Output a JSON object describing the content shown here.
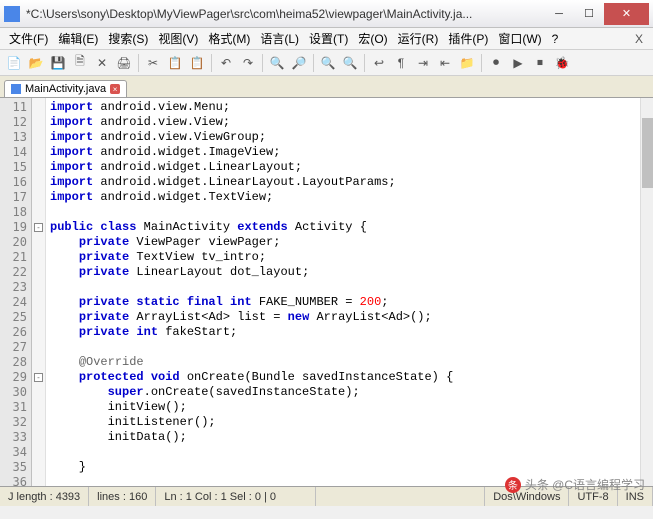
{
  "title": "*C:\\Users\\sony\\Desktop\\MyViewPager\\src\\com\\heima52\\viewpager\\MainActivity.ja...",
  "menu": [
    "文件(F)",
    "编辑(E)",
    "搜索(S)",
    "视图(V)",
    "格式(M)",
    "语言(L)",
    "设置(T)",
    "宏(O)",
    "运行(R)",
    "插件(P)",
    "窗口(W)",
    "?"
  ],
  "tab": {
    "label": "MainActivity.java"
  },
  "lines": [
    {
      "n": 11,
      "t": "import",
      "r": " android.view.Menu;"
    },
    {
      "n": 12,
      "t": "import",
      "r": " android.view.View;"
    },
    {
      "n": 13,
      "t": "import",
      "r": " android.view.ViewGroup;"
    },
    {
      "n": 14,
      "t": "import",
      "r": " android.widget.ImageView;"
    },
    {
      "n": 15,
      "t": "import",
      "r": " android.widget.LinearLayout;"
    },
    {
      "n": 16,
      "t": "import",
      "r": " android.widget.LinearLayout.LayoutParams;"
    },
    {
      "n": 17,
      "t": "import",
      "r": " android.widget.TextView;"
    },
    {
      "n": 18,
      "t": "",
      "r": ""
    },
    {
      "n": 19,
      "raw": "<span class='kw'>public</span> <span class='kw'>class</span> MainActivity <span class='kw'>extends</span> Activity {"
    },
    {
      "n": 20,
      "raw": "    <span class='kw'>private</span> ViewPager viewPager;"
    },
    {
      "n": 21,
      "raw": "    <span class='kw'>private</span> TextView tv_intro;"
    },
    {
      "n": 22,
      "raw": "    <span class='kw'>private</span> LinearLayout dot_layout;"
    },
    {
      "n": 23,
      "raw": ""
    },
    {
      "n": 24,
      "raw": "    <span class='kw'>private static final int</span> FAKE_NUMBER = <span class='num'>200</span>;"
    },
    {
      "n": 25,
      "raw": "    <span class='kw'>private</span> ArrayList&lt;Ad&gt; list = <span class='kw'>new</span> ArrayList&lt;Ad&gt;();"
    },
    {
      "n": 26,
      "raw": "    <span class='kw'>private int</span> fakeStart;"
    },
    {
      "n": 27,
      "raw": ""
    },
    {
      "n": 28,
      "raw": "    <span class='ann'>@Override</span>"
    },
    {
      "n": 29,
      "raw": "    <span class='kw'>protected void</span> onCreate(Bundle savedInstanceState) {"
    },
    {
      "n": 30,
      "raw": "        <span class='kw'>super</span>.onCreate(savedInstanceState);"
    },
    {
      "n": 31,
      "raw": "        initView();"
    },
    {
      "n": 32,
      "raw": "        initListener();"
    },
    {
      "n": 33,
      "raw": "        initData();"
    },
    {
      "n": 34,
      "raw": ""
    },
    {
      "n": 35,
      "raw": "    }"
    },
    {
      "n": 36,
      "raw": ""
    }
  ],
  "fold": [
    {
      "line": 19,
      "sym": "-"
    },
    {
      "line": 29,
      "sym": "-"
    }
  ],
  "status": {
    "length": "J length : 4393",
    "lines": "lines : 160",
    "pos": "Ln : 1   Col : 1   Sel : 0 | 0",
    "eol": "Dos\\Windows",
    "enc": "UTF-8",
    "ins": "INS"
  },
  "watermark": "头条 @C语言编程学习",
  "icons": {
    "new": "📄",
    "open": "📂",
    "save": "💾",
    "saveall": "🗎",
    "close": "✕",
    "print": "🖨",
    "cut": "✂",
    "copy": "📋",
    "paste": "📋",
    "undo": "↶",
    "redo": "↷",
    "find": "🔍",
    "replace": "🔎",
    "zoom": "🔍",
    "wrap": "↩",
    "hidden": "¶",
    "indent": "⇥",
    "outdent": "⇤",
    "folder": "📁",
    "rec": "⏺",
    "play": "▶",
    "stop": "⏹",
    "bug": "🐞"
  }
}
